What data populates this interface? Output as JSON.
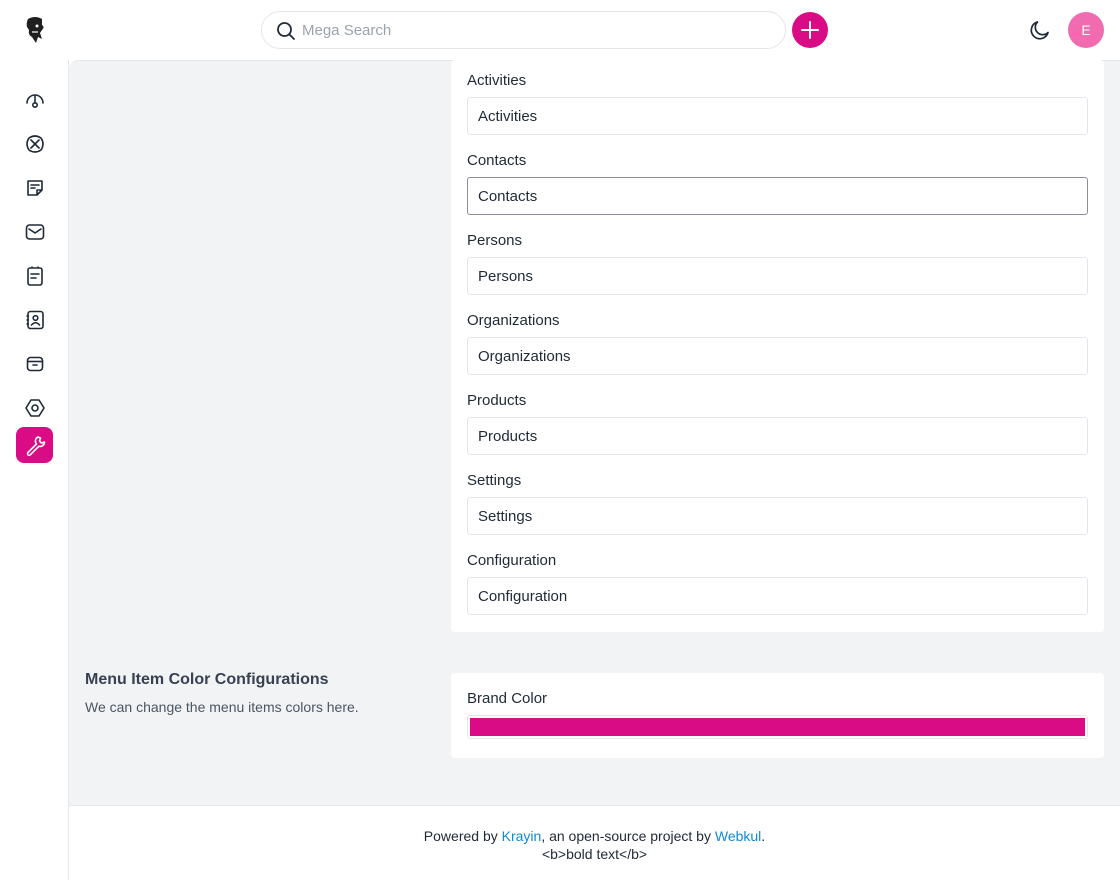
{
  "header": {
    "search_placeholder": "Mega Search",
    "avatar_initial": "E"
  },
  "colors": {
    "brand": "#d90c85"
  },
  "sidebar": {
    "items": [
      {
        "icon": "dashboard-icon"
      },
      {
        "icon": "leads-icon"
      },
      {
        "icon": "quotes-icon"
      },
      {
        "icon": "mail-icon"
      },
      {
        "icon": "activities-icon"
      },
      {
        "icon": "contacts-icon"
      },
      {
        "icon": "products-icon"
      },
      {
        "icon": "settings-icon"
      },
      {
        "icon": "configuration-icon",
        "active": true
      }
    ]
  },
  "menu_fields": [
    {
      "label": "Activities",
      "value": "Activities"
    },
    {
      "label": "Contacts",
      "value": "Contacts"
    },
    {
      "label": "Persons",
      "value": "Persons"
    },
    {
      "label": "Organizations",
      "value": "Organizations"
    },
    {
      "label": "Products",
      "value": "Products"
    },
    {
      "label": "Settings",
      "value": "Settings"
    },
    {
      "label": "Configuration",
      "value": "Configuration"
    }
  ],
  "color_section": {
    "title": "Menu Item Color Configurations",
    "description": "We can change the menu items colors here.",
    "brand_color_label": "Brand Color",
    "brand_color_value": "#d90c85"
  },
  "footer": {
    "prefix": "Powered by ",
    "krayin_link": "Krayin",
    "middle": ", an open-source project by ",
    "webkul_link": "Webkul",
    "suffix": ".",
    "line2": "<b>bold text</b>"
  }
}
